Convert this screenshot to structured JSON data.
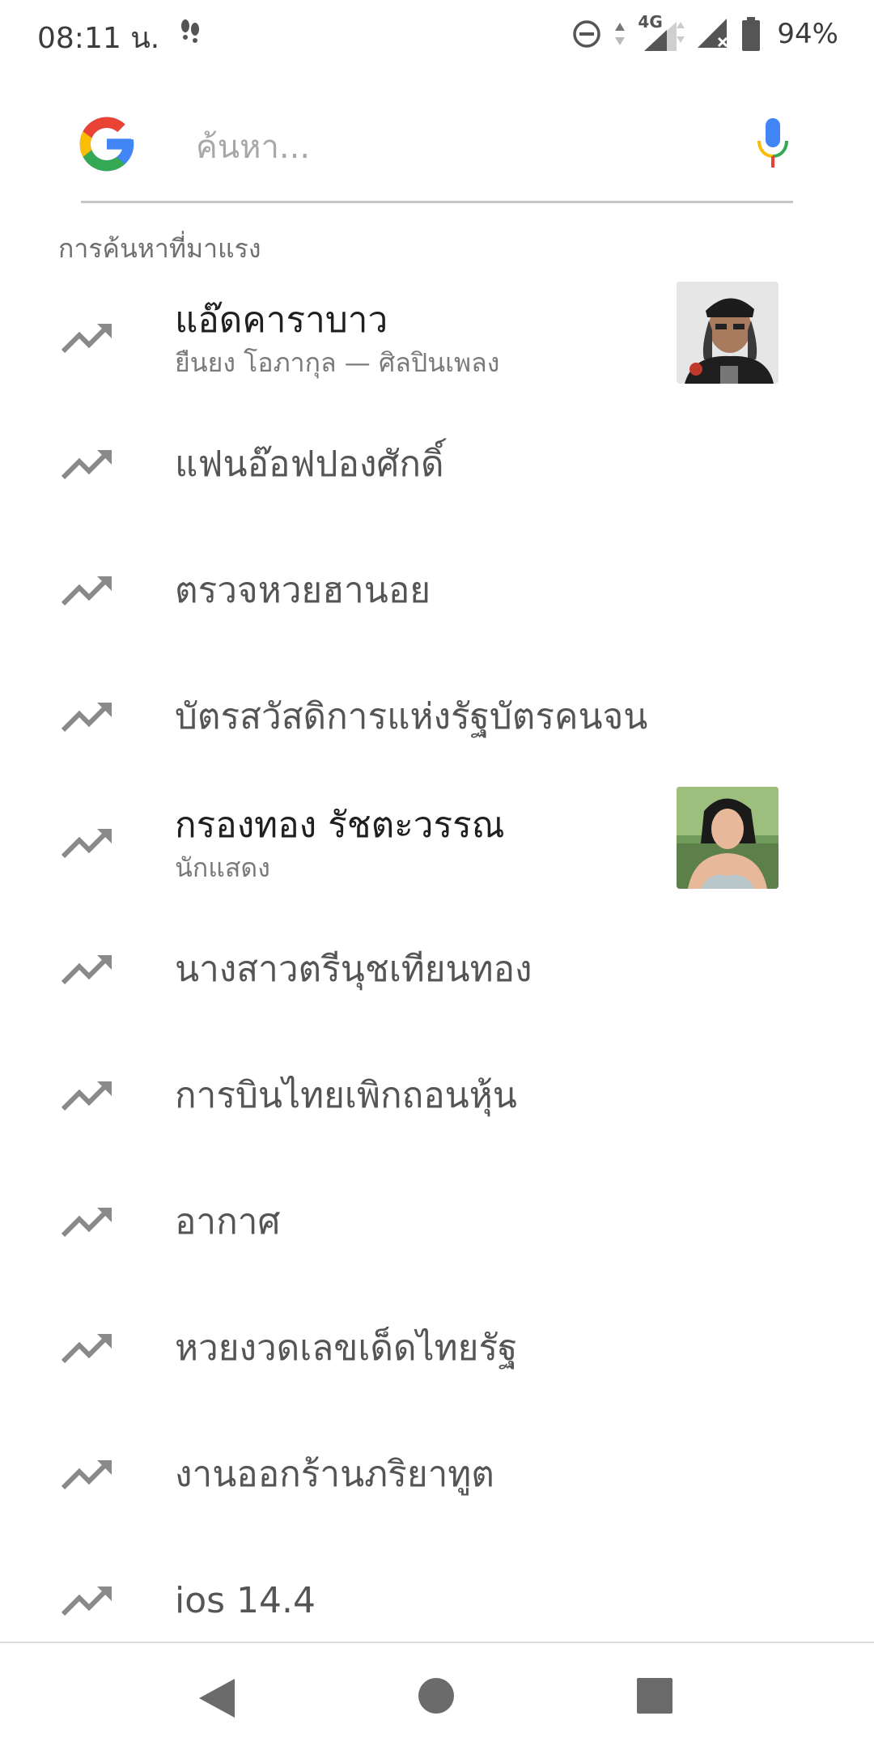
{
  "status_bar": {
    "time": "08:11 น.",
    "network": "4G",
    "battery": "94%"
  },
  "search": {
    "placeholder": "ค้นหา..."
  },
  "trending": {
    "heading": "การค้นหาที่มาแรง",
    "items": [
      {
        "title": "แอ๊ดคาราบาว",
        "subtitle": "ยืนยง โอภากุล — ศิลปินเพลง"
      },
      {
        "title": "แฟนอ๊อฟปองศักดิ์"
      },
      {
        "title": "ตรวจหวยฮานอย"
      },
      {
        "title": "บัตรสวัสดิการแห่งรัฐบัตรคนจน"
      },
      {
        "title": "กรองทอง รัชตะวรรณ",
        "subtitle": "นักแสดง"
      },
      {
        "title": "นางสาวตรีนุชเทียนทอง"
      },
      {
        "title": "การบินไทยเพิกถอนหุ้น"
      },
      {
        "title": "อากาศ"
      },
      {
        "title": "หวยงวดเลขเด็ดไทยรัฐ"
      },
      {
        "title": "งานออกร้านภริยาทูต"
      },
      {
        "title": "ios 14.4"
      }
    ]
  },
  "icons": {
    "trend": "trending-up-icon",
    "mic": "mic-icon",
    "back": "back-triangle-icon",
    "home": "home-circle-icon",
    "recents": "recents-square-icon"
  },
  "colors": {
    "google_blue": "#4285F4",
    "google_red": "#EA4335",
    "google_yellow": "#FBBC05",
    "google_green": "#34A853",
    "trend_icon": "#8a8a8a"
  }
}
